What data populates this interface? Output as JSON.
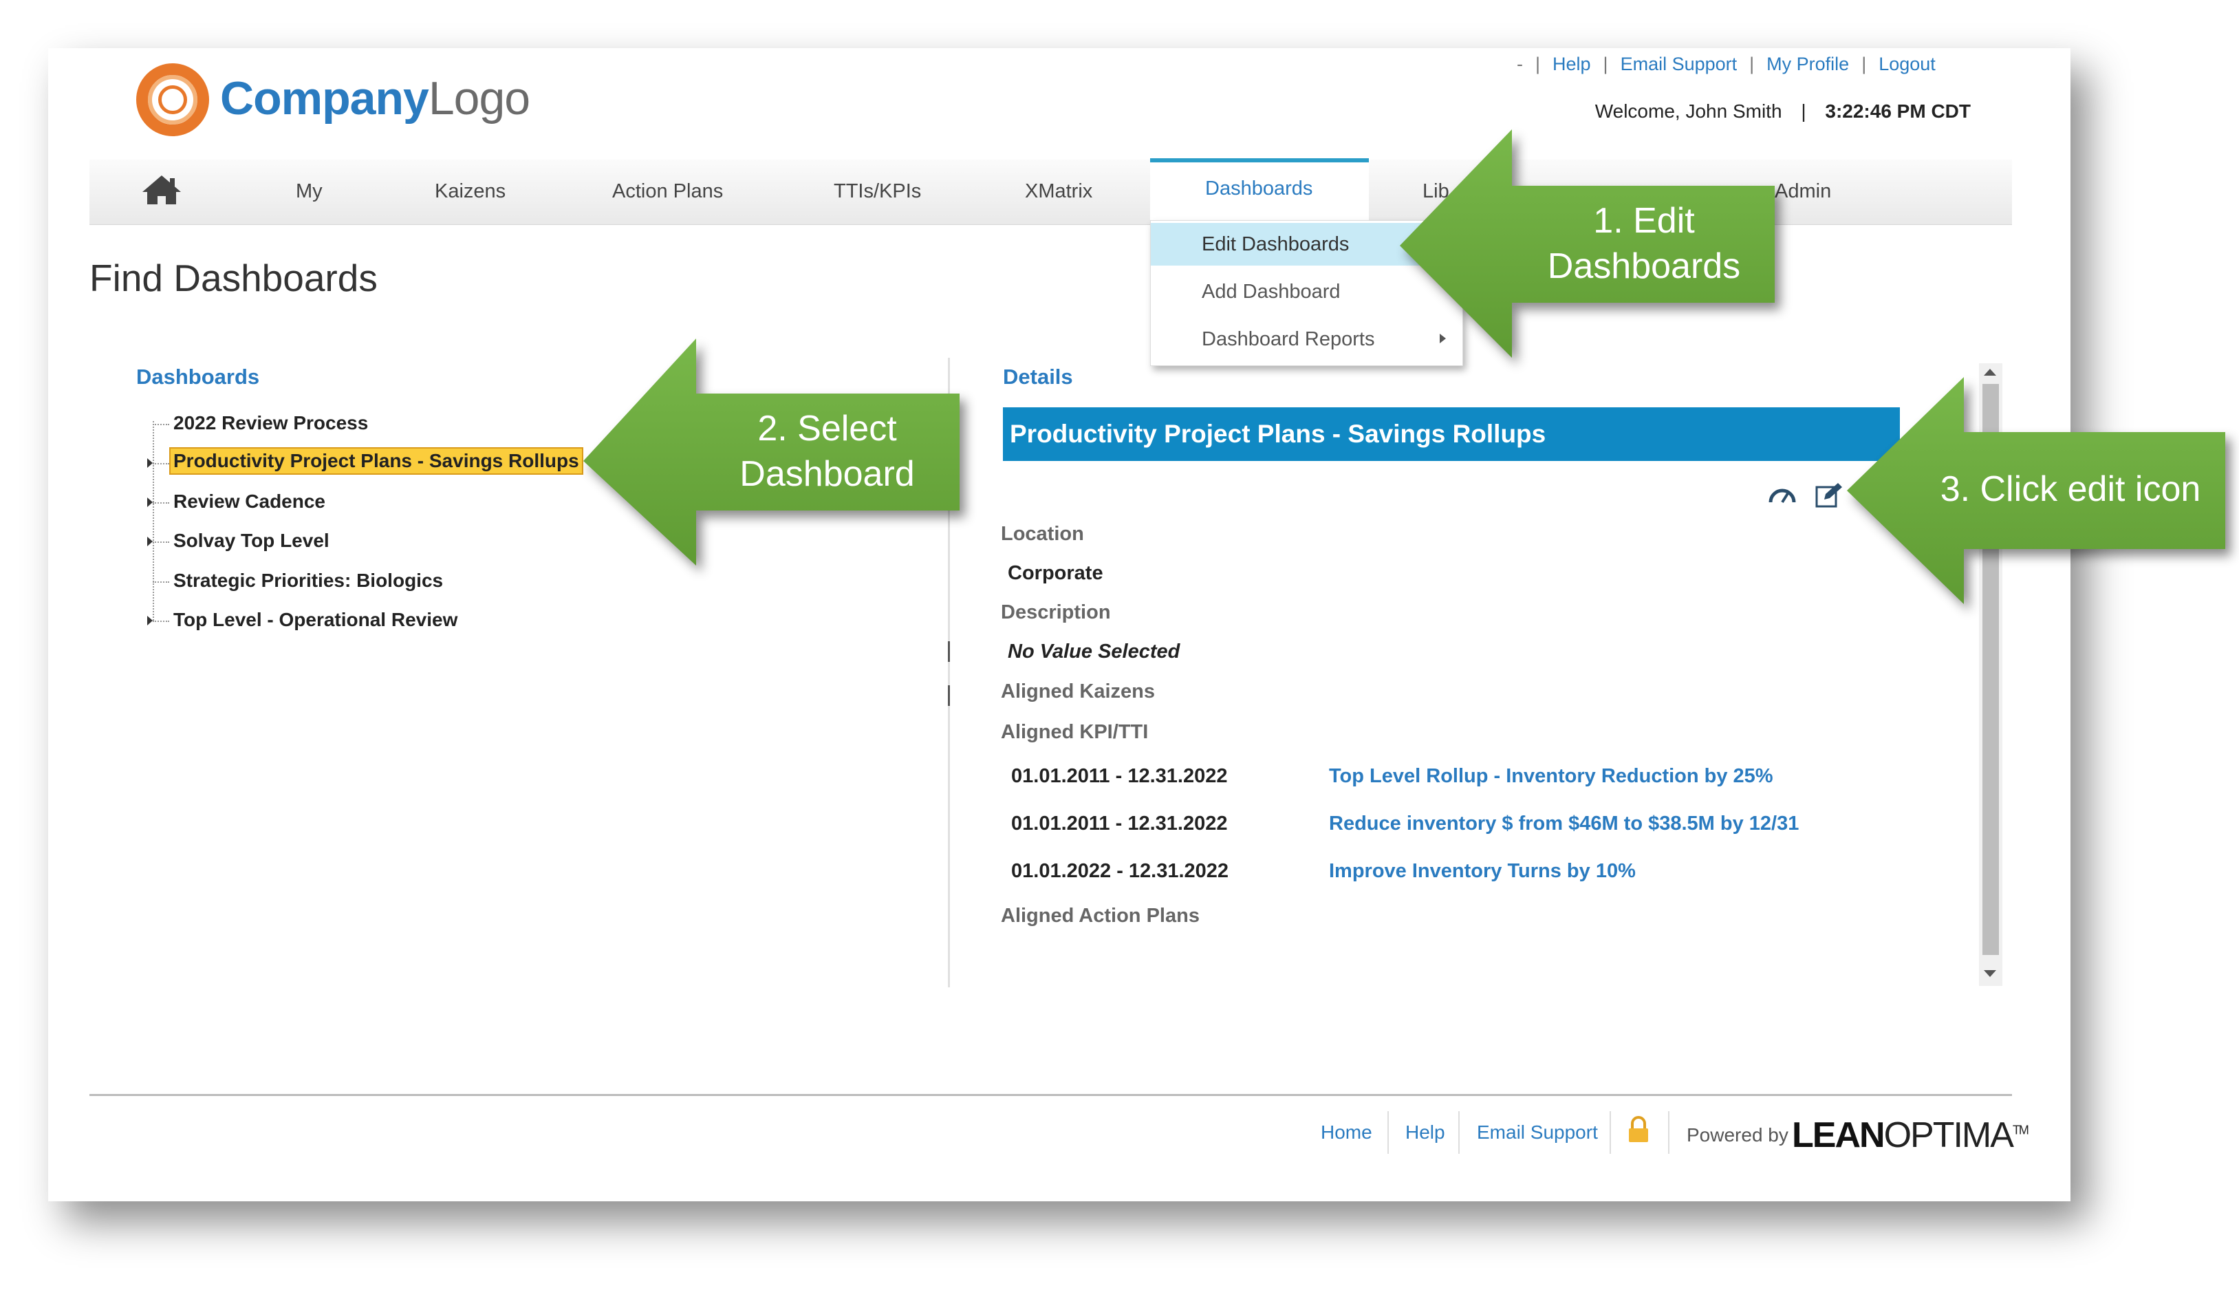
{
  "header": {
    "top_links": [
      "-",
      "Help",
      "Email Support",
      "My Profile",
      "Logout"
    ],
    "welcome": "Welcome, John Smith",
    "time": "3:22:46 PM CDT",
    "logo_company": "Company",
    "logo_logo": "Logo"
  },
  "nav": {
    "items": [
      "My",
      "Kaizens",
      "Action Plans",
      "TTIs/KPIs",
      "XMatrix",
      "Dashboards",
      "Lib",
      "Admin"
    ],
    "active": "Dashboards"
  },
  "dropdown": {
    "items": [
      "Edit Dashboards",
      "Add Dashboard",
      "Dashboard Reports"
    ]
  },
  "page": {
    "title": "Find Dashboards",
    "dashboards_heading": "Dashboards",
    "details_heading": "Details"
  },
  "tree": {
    "items": [
      "2022 Review Process",
      "Productivity Project Plans - Savings Rollups",
      "Review Cadence",
      "Solvay Top Level",
      "Strategic Priorities: Biologics",
      "Top Level - Operational Review"
    ],
    "selected": "Productivity Project Plans - Savings Rollups"
  },
  "details": {
    "banner": "Productivity Project Plans - Savings Rollups",
    "location_label": "Location",
    "location_value": "Corporate",
    "description_label": "Description",
    "description_value": "No Value Selected",
    "aligned_kaizens_label": "Aligned Kaizens",
    "aligned_kpi_label": "Aligned KPI/TTI",
    "kpis": [
      {
        "dates": "01.01.2011 - 12.31.2022",
        "name": "Top Level Rollup - Inventory Reduction by 25%"
      },
      {
        "dates": "01.01.2011 - 12.31.2022",
        "name": "Reduce inventory $ from $46M to $38.5M by 12/31"
      },
      {
        "dates": "01.01.2022 - 12.31.2022",
        "name": "Improve Inventory Turns by 10%"
      }
    ],
    "aligned_action_plans_label": "Aligned Action Plans"
  },
  "footer": {
    "links": [
      "Home",
      "Help",
      "Email Support"
    ],
    "powered_by": "Powered by",
    "lean_bold": "LEAN",
    "lean_light": "OPTIMA",
    "tm": "TM"
  },
  "callouts": {
    "one": "1. Edit Dashboards",
    "two": "2. Select Dashboard",
    "three": "3. Click edit icon"
  },
  "colors": {
    "accent": "#2a7bc0",
    "banner": "#1089c4",
    "callout_green": "#6aaa3a",
    "selected_bg": "#fbcd3c",
    "logo_orange": "#e8782a"
  },
  "icons": [
    "home-icon",
    "gauge-icon",
    "edit-icon",
    "lock-icon",
    "submenu-arrow-icon"
  ]
}
